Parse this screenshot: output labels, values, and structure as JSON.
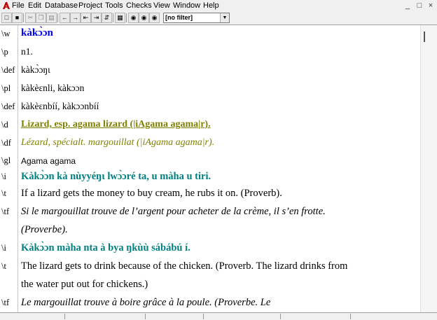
{
  "menu": [
    "File",
    "Edit",
    "Database",
    "Project",
    "Tools",
    "Checks",
    "View",
    "Window",
    "Help"
  ],
  "window_controls": [
    "_",
    "□",
    "×"
  ],
  "toolbar": {
    "icons": [
      "new-icon",
      "save-icon",
      "cut-icon",
      "copy-icon",
      "paste-icon",
      "first-record-icon",
      "previous-record-icon",
      "next-record-icon",
      "last-record-icon",
      "browse-icon",
      "find-icon",
      "find-next-icon",
      "find-previous-icon"
    ],
    "filter_value": "[no filter]"
  },
  "entry": {
    "lx": {
      "marker": "\\w",
      "value": "kàkɔ̀ɔn"
    },
    "ps": {
      "marker": "\\p",
      "value": "n1."
    },
    "def1": {
      "marker": "\\def",
      "value": "kàkɔ̀ɔŋɩ"
    },
    "pl": {
      "marker": "\\pl",
      "value": "kàkèɛnli, kàkɔɔn"
    },
    "def2": {
      "marker": "\\def",
      "value": "kàkèɛnbíí, kàkɔɔnbíí"
    },
    "d": {
      "marker": "\\d",
      "value": "Lizard, esp. agama lizard (|iAgama agama|r)."
    },
    "df": {
      "marker": "\\df",
      "value": "Lézard, spécialt. margouillat (|iAgama agama|r)."
    },
    "gl": {
      "marker": "\\gl",
      "value": "Agama agama"
    },
    "ex1": {
      "marker": "\\i",
      "value": "Kàkɔ̀ɔn kà nùyyéŋɩ lwɔ̀ɔré ta, u màha u tiri."
    },
    "tr1": {
      "marker": "\\t",
      "value": "If a lizard gets the money to buy cream, he rubs it on. (Proverb)."
    },
    "tf1a": {
      "marker": "\\tf",
      "value": "Si le margouillat trouve de l’argent pour acheter de la crème, il s’en frotte."
    },
    "tf1b": {
      "marker": "",
      "value": "(Proverbe)."
    },
    "ex2": {
      "marker": "\\i",
      "value": "Kàkɔ̀ɔn màha nta à bya ŋkùù sábábú í."
    },
    "tr2a": {
      "marker": "\\t",
      "value": "The lizard gets to drink because of the chicken. (Proverb. The lizard drinks from"
    },
    "tr2b": {
      "marker": "",
      "value": "the water put out for chickens.)"
    },
    "tf2": {
      "marker": "\\tf",
      "value": "Le margouillat trouve à boire grâce à la poule. (Proverbe. Le"
    }
  },
  "colors": {
    "lexeme": "#0000ff",
    "definition": "#808000",
    "example": "#008080"
  }
}
